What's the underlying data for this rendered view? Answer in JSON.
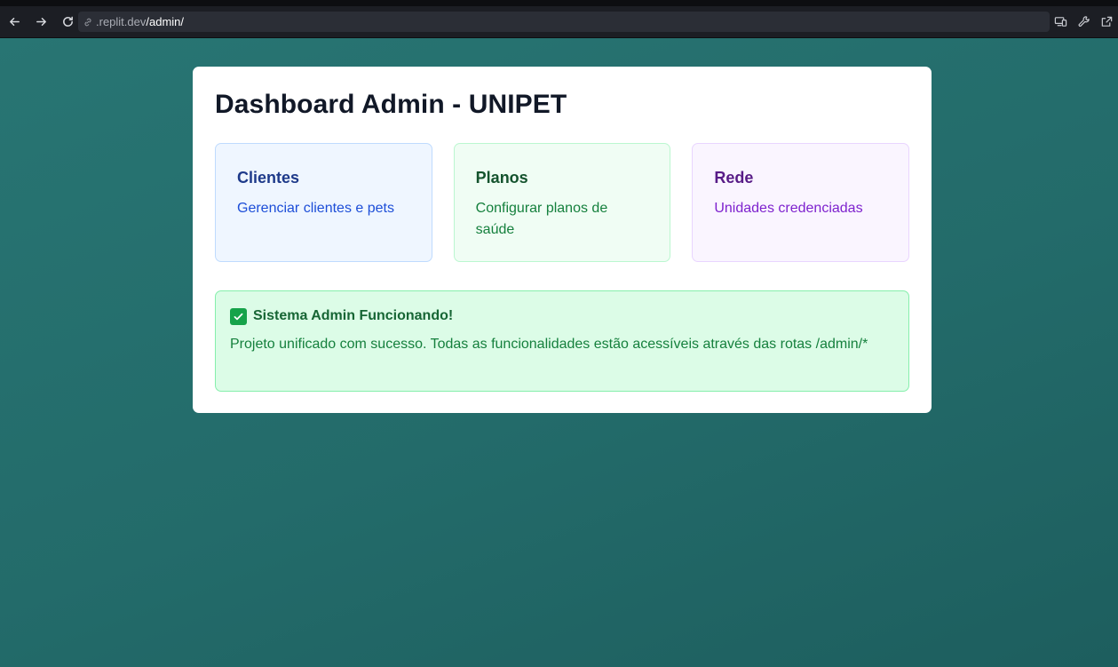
{
  "browser": {
    "url_host": ".replit.dev",
    "url_path": "/admin/",
    "icons": [
      "arrow-left-icon",
      "arrow-right-icon",
      "reload-icon",
      "link-icon",
      "devices-icon",
      "wrench-icon",
      "external-link-icon"
    ]
  },
  "dashboard": {
    "title": "Dashboard Admin - UNIPET",
    "tiles": [
      {
        "title": "Clientes",
        "description": "Gerenciar clientes e pets",
        "color": "#eff6ff"
      },
      {
        "title": "Planos",
        "description": "Configurar planos de saúde",
        "color": "#f0fdf4"
      },
      {
        "title": "Rede",
        "description": "Unidades credenciadas",
        "color": "#faf5ff"
      }
    ],
    "status": {
      "icon": "check-mark-icon",
      "title": "Sistema Admin Funcionando!",
      "message": "Projeto unificado com sucesso. Todas as funcionalidades estão acessíveis através das rotas /admin/*"
    }
  },
  "colors": {
    "background": "#277270",
    "accent_green": "#16a34a"
  }
}
